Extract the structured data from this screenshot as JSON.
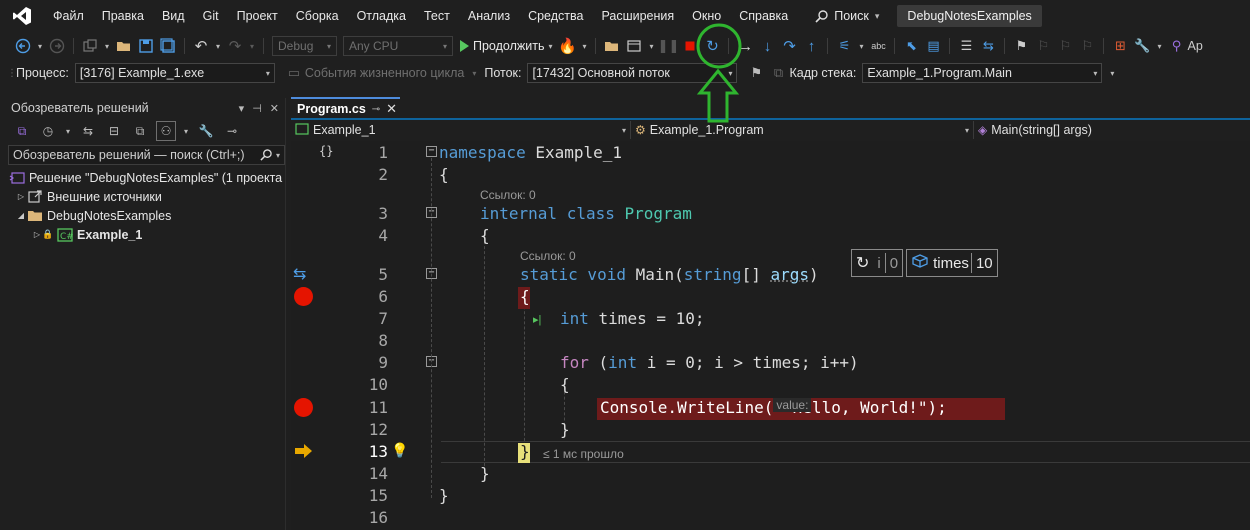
{
  "menubar": {
    "items": [
      "Файл",
      "Правка",
      "Вид",
      "Git",
      "Проект",
      "Сборка",
      "Отладка",
      "Тест",
      "Анализ",
      "Средства",
      "Расширения",
      "Окно",
      "Справка"
    ],
    "search_label": "Поиск",
    "solution_title": "DebugNotesExamples",
    "accent_color": "#9b6fe0"
  },
  "toolbar": {
    "config_combo": "Debug",
    "platform_combo": "Any CPU",
    "continue_label": "Продолжить",
    "trailing_label": "Ар",
    "stop_color": "#e51400"
  },
  "debugbar": {
    "process_label": "Процесс:",
    "process_value": "[3176] Example_1.exe",
    "lifecycle_label": "События жизненного цикла",
    "thread_label": "Поток:",
    "thread_value": "[17432] Основной поток",
    "frame_label": "Кадр стека:",
    "frame_value": "Example_1.Program.Main"
  },
  "solution_explorer": {
    "title": "Обозреватель решений",
    "search_placeholder": "Обозреватель решений — поиск (Ctrl+;)",
    "solution_row": "Решение \"DebugNotesExamples\" (1 проекта",
    "external_sources": "Внешние источники",
    "folder": "DebugNotesExamples",
    "project": "Example_1"
  },
  "editor": {
    "tab_label": "Program.cs",
    "nav_project": "Example_1",
    "nav_class": "Example_1.Program",
    "nav_member": "Main(string[] args)",
    "line_numbers": [
      "1",
      "2",
      "3",
      "4",
      "5",
      "6",
      "7",
      "8",
      "9",
      "10",
      "11",
      "12",
      "13",
      "14",
      "15",
      "16"
    ],
    "current_line": "13",
    "ref_lens_1": "Ссылок: 0",
    "ref_lens_2": "Ссылок: 0",
    "elapsed_hint": "≤ 1 мс прошло",
    "param_hint": "value:",
    "datatip": {
      "i_name": "i",
      "i_value": "0",
      "times_name": "times",
      "times_value": "10"
    },
    "code": {
      "l1_kw": "namespace",
      "l1_name": " Example_1",
      "l2": "{",
      "l3_kw": "internal class",
      "l3_type": " Program",
      "l4": "{",
      "l5_kw": "static void",
      "l5_name": " Main(",
      "l5_kw2": "string",
      "l5_rest": "[] ",
      "l5_args": "args",
      "l5_close": ")",
      "l6": "{",
      "l7_kw": "int",
      "l7_rest": " times = 10;",
      "l9_kw": "for",
      "l9_a": " (",
      "l9_kw2": "int",
      "l9_rest": " i = 0; i > times; i++)",
      "l10": "{",
      "l11_call": "Console.WriteLine(",
      "l11_str": "\"Hello, World!\"",
      "l11_end": ");",
      "l12": "}",
      "l13": "}",
      "l14": "}",
      "l15": "}"
    }
  },
  "annotation": {
    "circle_color": "#2fb52f"
  }
}
